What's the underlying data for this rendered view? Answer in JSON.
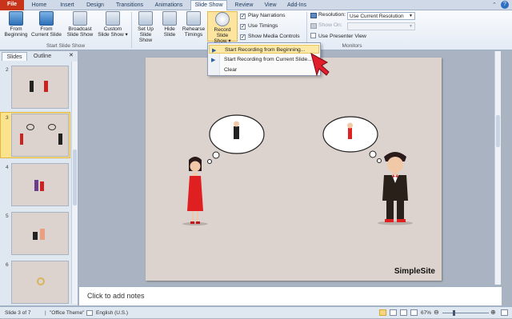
{
  "tabs": [
    "File",
    "Home",
    "Insert",
    "Design",
    "Transitions",
    "Animations",
    "Slide Show",
    "Review",
    "View",
    "Add-Ins"
  ],
  "active_tab": "Slide Show",
  "ribbon": {
    "from_beginning": [
      "From",
      "Beginning"
    ],
    "from_current": [
      "From",
      "Current Slide"
    ],
    "broadcast": [
      "Broadcast",
      "Slide Show"
    ],
    "custom": [
      "Custom",
      "Slide Show ▾"
    ],
    "group_start": "Start Slide Show",
    "setup": [
      "Set Up",
      "Slide Show"
    ],
    "hide": [
      "Hide",
      "Slide"
    ],
    "rehearse": [
      "Rehearse",
      "Timings"
    ],
    "record": [
      "Record Slide",
      "Show ▾"
    ],
    "play_narrations": "Play Narrations",
    "use_timings": "Use Timings",
    "show_media_controls": "Show Media Controls",
    "resolution_label": "Resolution:",
    "resolution_value": "Use Current Resolution",
    "show_on_label": "Show On:",
    "use_presenter_view": "Use Presenter View",
    "group_monitors": "Monitors"
  },
  "menu": {
    "item1": "Start Recording from Beginning...",
    "item2": "Start Recording from Current Slide...",
    "item3": "Clear"
  },
  "pane": {
    "tab_slides": "Slides",
    "tab_outline": "Outline",
    "nums": [
      "2",
      "3",
      "4",
      "5",
      "6"
    ]
  },
  "slide": {
    "brand": "SimpleSite"
  },
  "notes_placeholder": "Click to add notes",
  "status": {
    "slide": "Slide 3 of 7",
    "theme": "\"Office Theme\"",
    "lang": "English (U.S.)",
    "zoom": "67%"
  },
  "colors": {
    "accent": "#c8341a",
    "dress": "#e02020"
  }
}
